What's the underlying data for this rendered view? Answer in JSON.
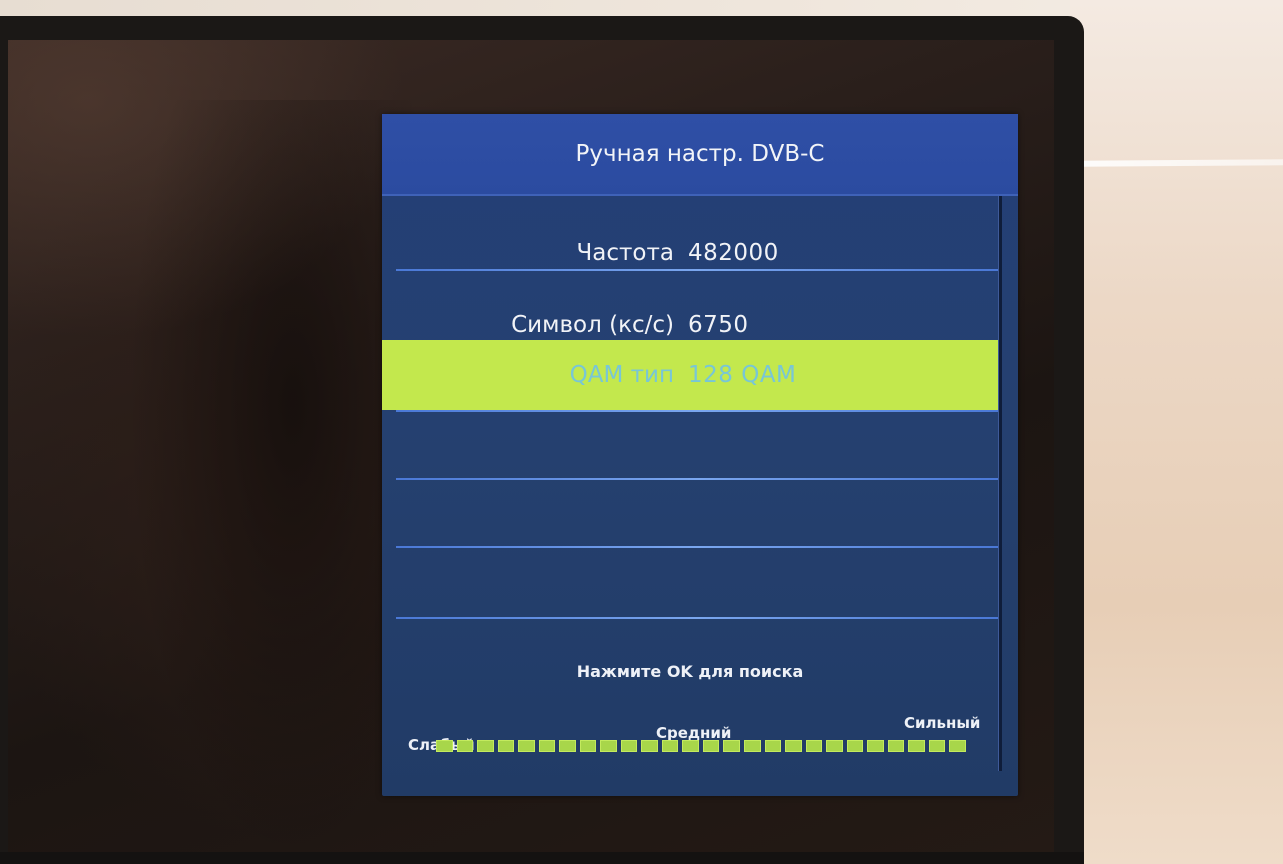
{
  "osd": {
    "title": "Ручная настр. DVB-C",
    "rows": [
      {
        "label": "Частота",
        "value": "482000"
      },
      {
        "label": "Символ (кс/с)",
        "value": "6750"
      },
      {
        "label": "QAM тип",
        "value": "128 QAM"
      }
    ],
    "hint": "Нажмите OK для поиска",
    "signal": {
      "weak_label": "Слабый",
      "medium_label": "Средний",
      "strong_label": "Сильный",
      "segments": 26
    }
  },
  "colors": {
    "panel": "#243f77",
    "header": "#2f4fa6",
    "highlight": "#c3e84d",
    "highlight_text": "#78c6d6",
    "signal": "#a8d64a"
  }
}
